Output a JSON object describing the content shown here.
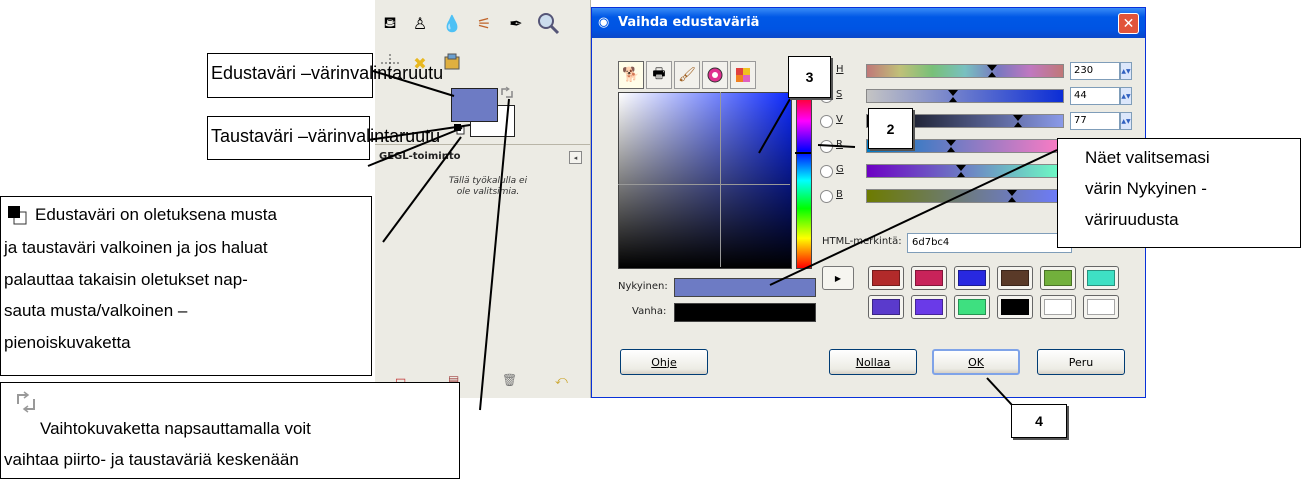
{
  "toolbox": {
    "tool_options_title": "GEGL-toiminto",
    "tool_options_note": "Tällä työkalulla ei ole valitsimia.",
    "fg_color": "#6d7bc4",
    "bg_color": "#ffffff"
  },
  "dialog": {
    "title": "Vaihda edustaväriä",
    "close_label": "✕",
    "channels": [
      {
        "key": "H",
        "value": "230",
        "level": 0.64
      },
      {
        "key": "S",
        "value": "44",
        "level": 0.44
      },
      {
        "key": "V",
        "value": "77",
        "level": 0.77
      },
      {
        "key": "R",
        "value": "",
        "level": 0.43
      },
      {
        "key": "G",
        "value": "",
        "level": 0.48
      },
      {
        "key": "B",
        "value": "",
        "level": 0.74
      }
    ],
    "html_label": "HTML-merkintä:",
    "html_value": "6d7bc4",
    "current_label": "Nykyinen:",
    "old_label": "Vanha:",
    "current_color": "#6d7bc4",
    "old_color": "#000000",
    "history_colors": [
      [
        "#b22a2a",
        "#c8235a",
        "#2828e0",
        "#5a3a28",
        "#72b03c",
        "#3ee0c4"
      ],
      [
        "#5a3acc",
        "#6a3ae8",
        "#3ee080",
        "#000000",
        "#ffffff",
        "#ffffff"
      ]
    ],
    "buttons": {
      "help": "Ohje",
      "reset": "Nollaa",
      "ok": "OK",
      "cancel": "Peru"
    }
  },
  "annotations": {
    "fg_box": "Edustaväri –värinvalintaruutu",
    "bg_box": "Taustaväri –värinvalintaruutu",
    "default_note_lines": [
      "Edustaväri on oletuksena musta",
      "ja taustaväri valkoinen ja jos haluat",
      "palauttaa takaisin oletukset nap-",
      "sauta musta/valkoinen –",
      "pienoiskuvaketta"
    ],
    "swap_note_lines": [
      "Vaihtokuvaketta napsauttamalla voit",
      "vaihtaa piirto- ja taustaväriä keskenään"
    ],
    "current_note_lines": [
      "Näet valitsemasi",
      "värin Nykyinen -",
      "väriruudusta"
    ],
    "badge_2": "2",
    "badge_3": "3",
    "badge_4": "4"
  }
}
